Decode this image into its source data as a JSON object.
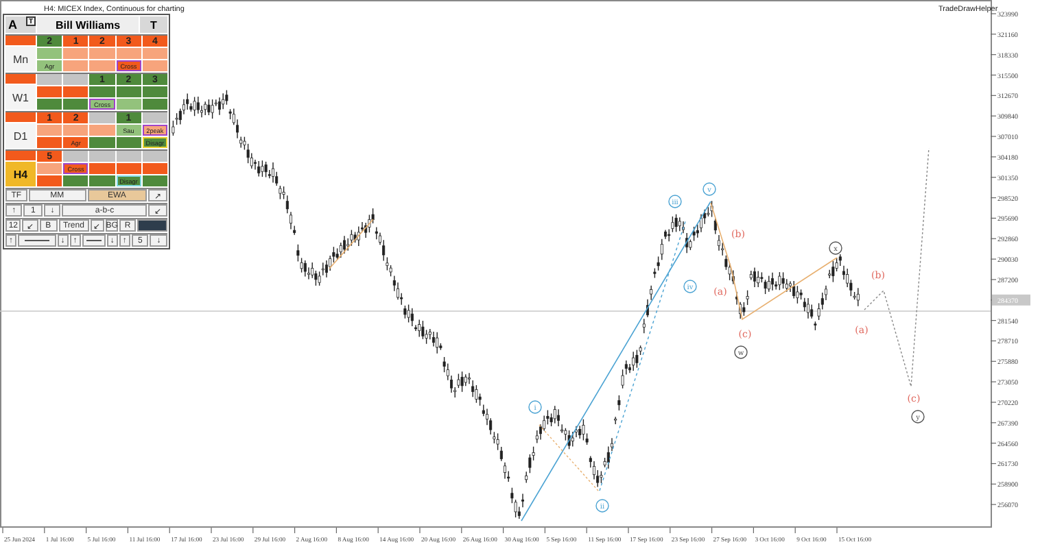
{
  "chart": {
    "title": "H4: MICEX Index, Continuous for charting",
    "indicator": "TradeDrawHelper",
    "price_axis": [
      {
        "text": "323990",
        "current": false
      },
      {
        "text": "321160",
        "current": false
      },
      {
        "text": "318330",
        "current": false
      },
      {
        "text": "315500",
        "current": false
      },
      {
        "text": "312670",
        "current": false
      },
      {
        "text": "309840",
        "current": false
      },
      {
        "text": "307010",
        "current": false
      },
      {
        "text": "304180",
        "current": false
      },
      {
        "text": "301350",
        "current": false
      },
      {
        "text": "298520",
        "current": false
      },
      {
        "text": "295690",
        "current": false
      },
      {
        "text": "292860",
        "current": false
      },
      {
        "text": "290030",
        "current": false
      },
      {
        "text": "287200",
        "current": false
      },
      {
        "text": "284370",
        "current": true
      },
      {
        "text": "281540",
        "current": false
      },
      {
        "text": "278710",
        "current": false
      },
      {
        "text": "275880",
        "current": false
      },
      {
        "text": "273050",
        "current": false
      },
      {
        "text": "270220",
        "current": false
      },
      {
        "text": "267390",
        "current": false
      },
      {
        "text": "264560",
        "current": false
      },
      {
        "text": "261730",
        "current": false
      },
      {
        "text": "258900",
        "current": false
      },
      {
        "text": "256070",
        "current": false
      }
    ],
    "time_axis": [
      "25 Jun 2024",
      "1 Jul 16:00",
      "5 Jul 16:00",
      "11 Jul 16:00",
      "17 Jul 16:00",
      "23 Jul 16:00",
      "29 Jul 16:00",
      "2 Aug 16:00",
      "8 Aug 16:00",
      "14 Aug 16:00",
      "20 Aug 16:00",
      "26 Aug 16:00",
      "30 Aug 16:00",
      "5 Sep 16:00",
      "11 Sep 16:00",
      "17 Sep 16:00",
      "23 Sep 16:00",
      "27 Sep 16:00",
      "3 Oct 16:00",
      "9 Oct 16:00",
      "15 Oct 16:00"
    ],
    "wave_labels": [
      {
        "text": "i",
        "kind": "circled",
        "color": "#4ba3d3"
      },
      {
        "text": "ii",
        "kind": "circled",
        "color": "#4ba3d3"
      },
      {
        "text": "iii",
        "kind": "circled",
        "color": "#4ba3d3"
      },
      {
        "text": "iv",
        "kind": "circled",
        "color": "#4ba3d3"
      },
      {
        "text": "v",
        "kind": "circled",
        "color": "#4ba3d3"
      },
      {
        "text": "(b)",
        "kind": "plain",
        "color": "#e0685e"
      },
      {
        "text": "(a)",
        "kind": "plain",
        "color": "#e0685e"
      },
      {
        "text": "(c)",
        "kind": "plain",
        "color": "#e0685e"
      },
      {
        "text": "w",
        "kind": "circled",
        "color": "#555555"
      },
      {
        "text": "x",
        "kind": "circled",
        "color": "#555555"
      },
      {
        "text": "(b)",
        "kind": "plain",
        "color": "#e0685e"
      },
      {
        "text": "(a)",
        "kind": "plain",
        "color": "#e0685e"
      },
      {
        "text": "(c)",
        "kind": "plain",
        "color": "#e0685e"
      },
      {
        "text": "y",
        "kind": "circled",
        "color": "#555555"
      }
    ]
  },
  "panel": {
    "left": "A",
    "badge": "T",
    "title": "Bill Williams",
    "right": "T",
    "timeframes": [
      {
        "label": "Mn",
        "selected": false,
        "rows": [
          [
            {
              "text": "2",
              "color": "#4f8a3c"
            },
            {
              "text": "1",
              "color": "#f25a1c"
            },
            {
              "text": "2",
              "color": "#f25a1c"
            },
            {
              "text": "3",
              "color": "#f25a1c"
            },
            {
              "text": "4",
              "color": "#f25a1c"
            }
          ],
          [
            {
              "color": "#93c27c"
            },
            {
              "color": "#f7a47c"
            },
            {
              "color": "#f7a47c"
            },
            {
              "color": "#f7a47c"
            },
            {
              "color": "#f7a47c"
            }
          ],
          [
            {
              "text": "Agr",
              "color": "#93c27c"
            },
            {
              "color": "#f7a47c"
            },
            {
              "color": "#f7a47c"
            },
            {
              "color": "#f25a1c",
              "tag": {
                "text": "Cross",
                "color": "#a044c8"
              }
            },
            {
              "color": "#f7a47c"
            }
          ]
        ]
      },
      {
        "label": "W1",
        "selected": false,
        "rows": [
          [
            {
              "color": "#c4c4c4"
            },
            {
              "color": "#c4c4c4"
            },
            {
              "text": "1",
              "color": "#4f8a3c"
            },
            {
              "text": "2",
              "color": "#4f8a3c"
            },
            {
              "text": "3",
              "color": "#4f8a3c"
            }
          ],
          [
            {
              "color": "#f25a1c"
            },
            {
              "color": "#f25a1c"
            },
            {
              "color": "#4f8a3c"
            },
            {
              "color": "#4f8a3c"
            },
            {
              "color": "#4f8a3c"
            }
          ],
          [
            {
              "color": "#4f8a3c"
            },
            {
              "color": "#4f8a3c"
            },
            {
              "color": "#93c27c",
              "tag": {
                "text": "Cross",
                "color": "#a044c8"
              }
            },
            {
              "color": "#93c27c"
            },
            {
              "color": "#4f8a3c"
            }
          ]
        ]
      },
      {
        "label": "D1",
        "selected": false,
        "rows": [
          [
            {
              "text": "1",
              "color": "#f25a1c"
            },
            {
              "text": "2",
              "color": "#f25a1c"
            },
            {
              "color": "#c4c4c4"
            },
            {
              "text": "1",
              "color": "#4f8a3c"
            },
            {
              "color": "#c4c4c4"
            }
          ],
          [
            {
              "color": "#f7a47c"
            },
            {
              "color": "#f7a47c"
            },
            {
              "color": "#f7a47c"
            },
            {
              "text": "Sau",
              "color": "#93c27c"
            },
            {
              "color": "#f7a47c",
              "tag": {
                "text": "2peak",
                "color": "#a044c8"
              }
            }
          ],
          [
            {
              "color": "#f25a1c"
            },
            {
              "text": "Agr",
              "color": "#f25a1c"
            },
            {
              "color": "#4f8a3c"
            },
            {
              "color": "#4f8a3c"
            },
            {
              "color": "#4f8a3c",
              "tag": {
                "text": "Disagr",
                "color": "#e8d030"
              }
            }
          ]
        ]
      },
      {
        "label": "H4",
        "selected": true,
        "rows": [
          [
            {
              "text": "5",
              "color": "#f25a1c"
            },
            {
              "color": "#c4c4c4"
            },
            {
              "color": "#c4c4c4"
            },
            {
              "color": "#c4c4c4"
            },
            {
              "color": "#c4c4c4"
            }
          ],
          [
            {
              "color": "#f7a47c"
            },
            {
              "color": "#f25a1c",
              "tag": {
                "text": "Cross",
                "color": "#a044c8"
              }
            },
            {
              "color": "#f25a1c"
            },
            {
              "color": "#f25a1c"
            },
            {
              "color": "#f25a1c"
            }
          ],
          [
            {
              "color": "#f25a1c"
            },
            {
              "color": "#4f8a3c"
            },
            {
              "color": "#4f8a3c"
            },
            {
              "color": "#4f8a3c",
              "tag": {
                "text": "Disagr",
                "color": "#7fd8e0"
              }
            },
            {
              "color": "#4f8a3c"
            }
          ]
        ]
      }
    ],
    "controls": [
      [
        {
          "kind": "button",
          "text": "TF",
          "selected": false
        },
        {
          "kind": "button",
          "text": "MM",
          "selected": false
        },
        {
          "kind": "button",
          "text": "EWA",
          "selected": true
        },
        {
          "kind": "button",
          "text": "↗",
          "selected": false
        }
      ],
      [
        {
          "kind": "button",
          "text": "↑",
          "selected": false
        },
        {
          "kind": "button",
          "text": "1",
          "selected": false
        },
        {
          "kind": "button",
          "text": "↓",
          "selected": false
        },
        {
          "kind": "button",
          "text": "a-b-c",
          "selected": false
        },
        {
          "kind": "button",
          "text": "↙",
          "selected": false
        }
      ],
      [
        {
          "kind": "button",
          "text": "12",
          "selected": false
        },
        {
          "kind": "button",
          "text": "↙",
          "selected": false
        },
        {
          "kind": "button",
          "text": "B",
          "selected": false
        },
        {
          "kind": "button",
          "text": "Trend",
          "selected": false
        },
        {
          "kind": "button",
          "text": "↙",
          "selected": false
        },
        {
          "kind": "button",
          "text": "BG",
          "selected": false
        },
        {
          "kind": "button",
          "text": "R",
          "selected": false
        },
        {
          "kind": "swatch",
          "color": "#2e3d4c"
        }
      ],
      [
        {
          "kind": "button",
          "text": "↑",
          "selected": false
        },
        {
          "kind": "line"
        },
        {
          "kind": "button",
          "text": "↓",
          "selected": false
        },
        {
          "kind": "button",
          "text": "↑",
          "selected": false
        },
        {
          "kind": "line"
        },
        {
          "kind": "button",
          "text": "↓",
          "selected": false
        },
        {
          "kind": "button",
          "text": "↑",
          "selected": false
        },
        {
          "kind": "button",
          "text": "5",
          "selected": false
        },
        {
          "kind": "button",
          "text": "↓",
          "selected": false
        }
      ]
    ]
  }
}
